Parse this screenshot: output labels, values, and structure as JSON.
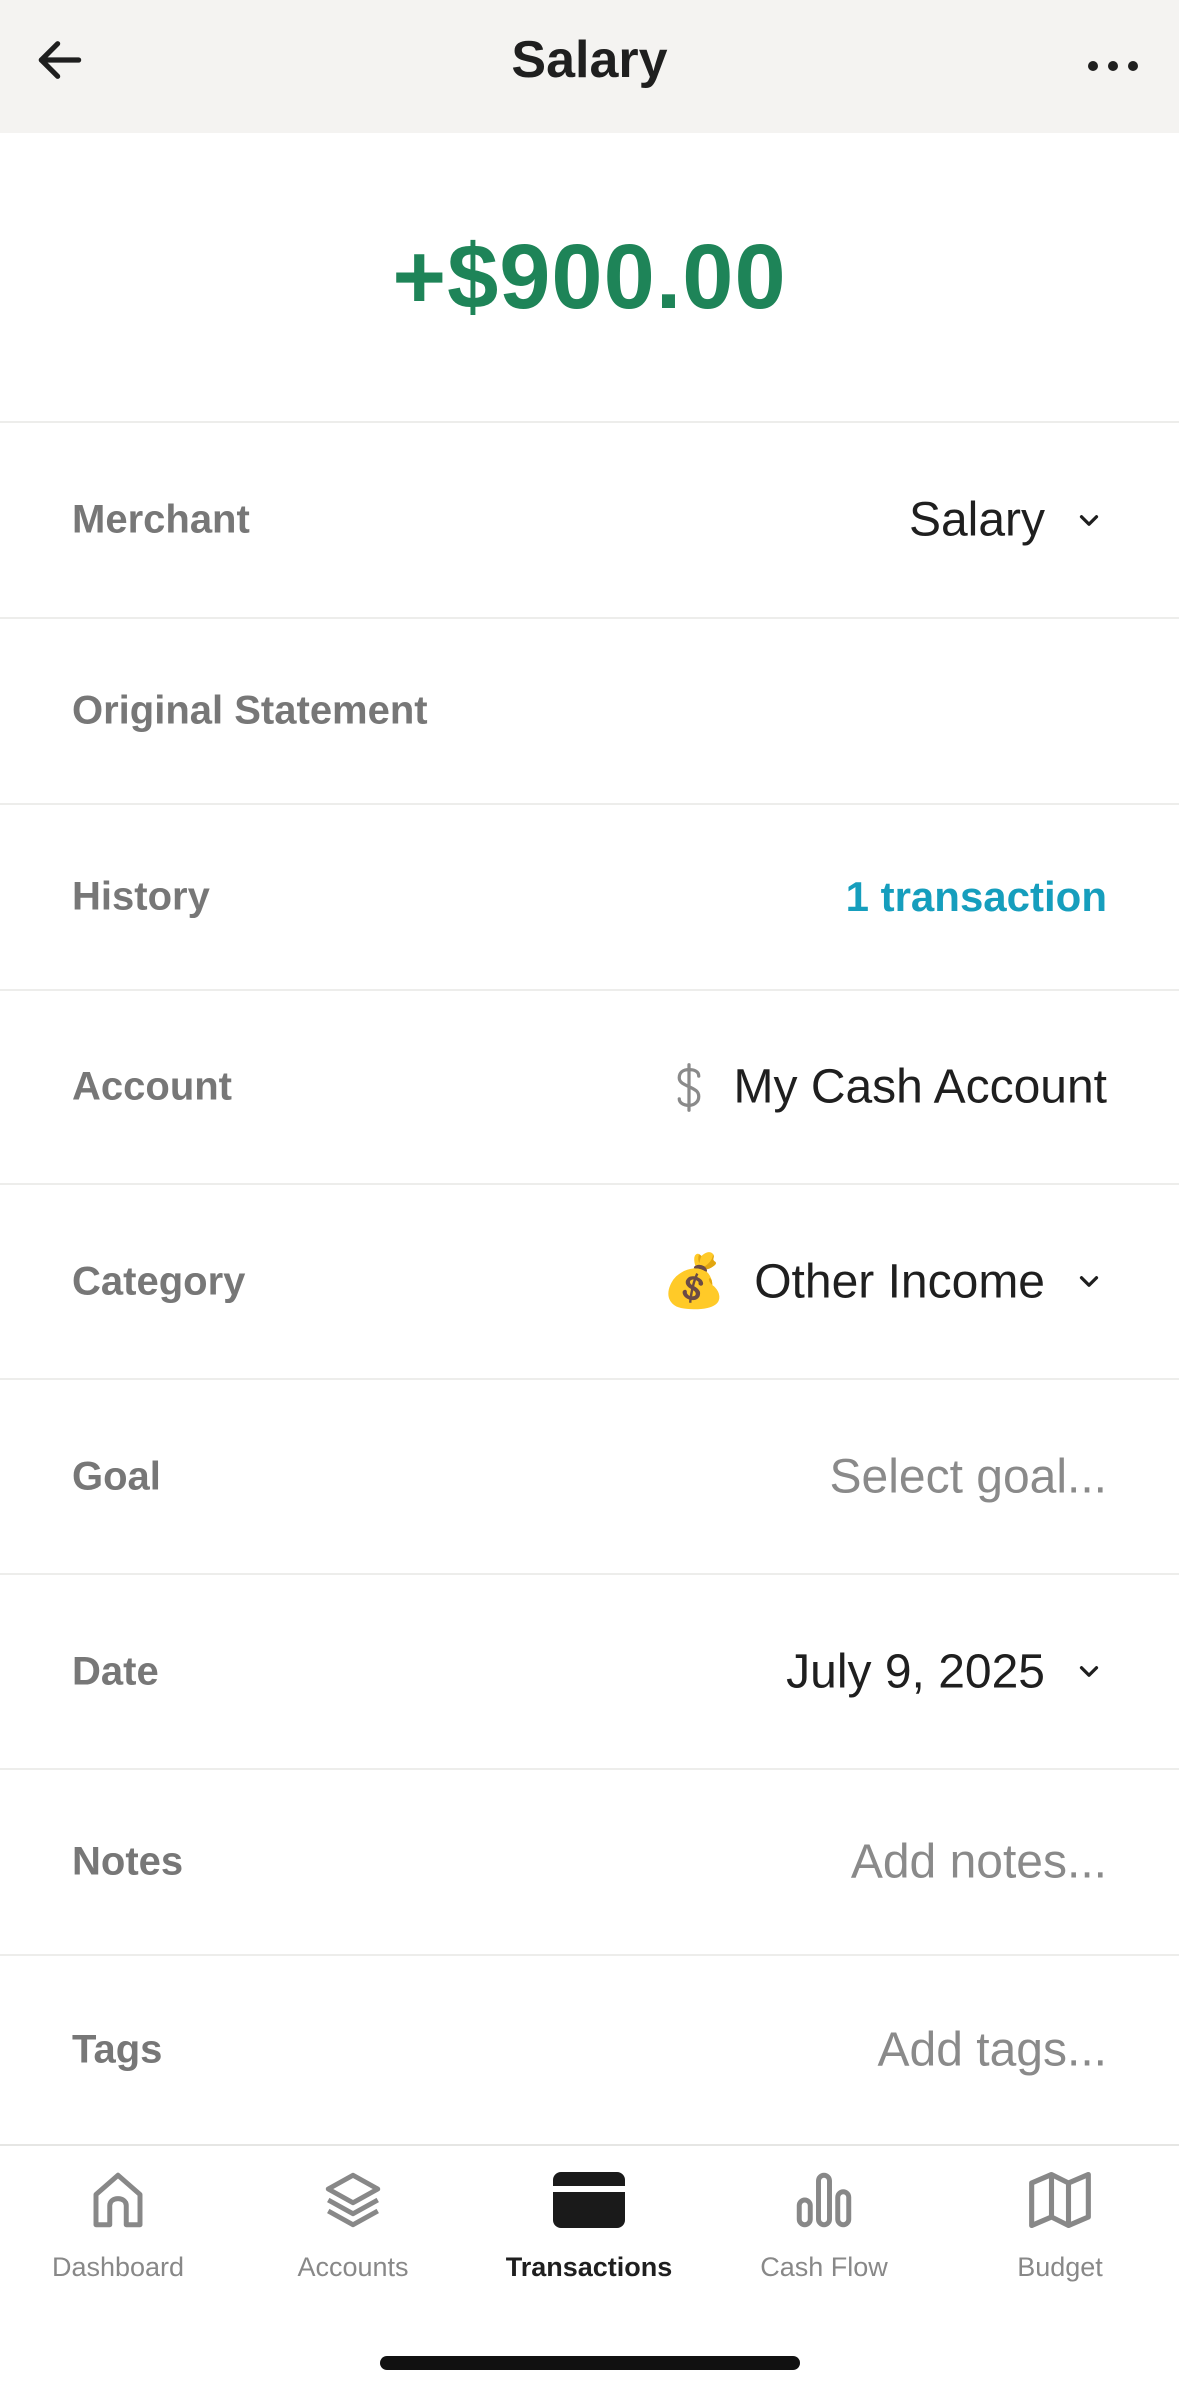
{
  "header": {
    "title": "Salary",
    "back_icon": "arrow-left-icon",
    "more_icon": "more-horizontal-icon"
  },
  "transaction": {
    "amount": "+$900.00",
    "amount_color": "#1e8458"
  },
  "fields": {
    "merchant": {
      "label": "Merchant",
      "value": "Salary"
    },
    "original_statement": {
      "label": "Original Statement",
      "value": ""
    },
    "history": {
      "label": "History",
      "value": "1 transaction",
      "link_color": "#169ebd"
    },
    "account": {
      "label": "Account",
      "value": "My Cash Account",
      "icon": "dollar-icon"
    },
    "category": {
      "label": "Category",
      "value": "Other Income",
      "emoji": "💰"
    },
    "goal": {
      "label": "Goal",
      "placeholder": "Select goal..."
    },
    "date": {
      "label": "Date",
      "value": "July 9, 2025"
    },
    "notes": {
      "label": "Notes",
      "placeholder": "Add notes..."
    },
    "tags": {
      "label": "Tags",
      "placeholder": "Add tags..."
    }
  },
  "tab_bar": {
    "items": [
      {
        "label": "Dashboard",
        "icon": "home-icon",
        "active": false
      },
      {
        "label": "Accounts",
        "icon": "layers-icon",
        "active": false
      },
      {
        "label": "Transactions",
        "icon": "credit-card-icon",
        "active": true
      },
      {
        "label": "Cash Flow",
        "icon": "bar-chart-icon",
        "active": false
      },
      {
        "label": "Budget",
        "icon": "map-icon",
        "active": false
      }
    ]
  }
}
